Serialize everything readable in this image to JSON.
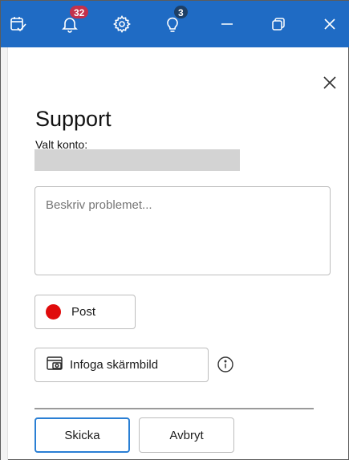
{
  "titlebar": {
    "notifications_count": "32",
    "tips_count": "3"
  },
  "panel": {
    "title": "Support",
    "account_label": "Valt konto:",
    "description_placeholder": "Beskriv problemet...",
    "post_label": "Post",
    "screenshot_label": "Infoga skärmbild",
    "send_label": "Skicka",
    "cancel_label": "Avbryt"
  },
  "colors": {
    "titlebar": "#1f6bc4",
    "badge_red": "#c4314b",
    "post_dot": "#e00b0b",
    "primary_border": "#2a7fd4"
  }
}
